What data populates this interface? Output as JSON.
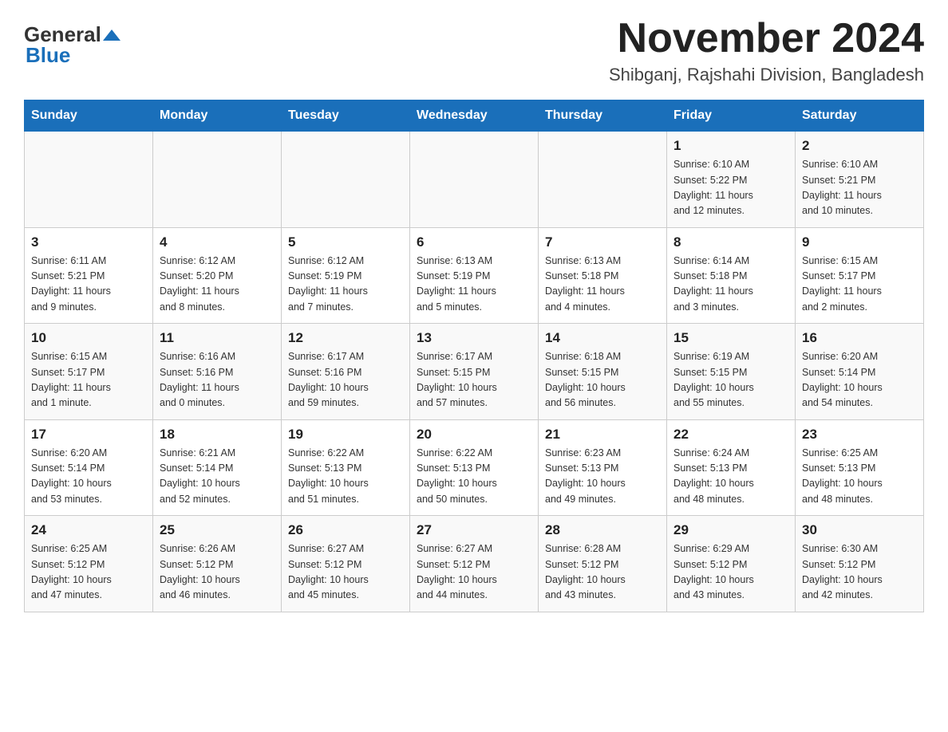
{
  "header": {
    "logo_general": "General",
    "logo_blue": "Blue",
    "month_title": "November 2024",
    "location": "Shibganj, Rajshahi Division, Bangladesh"
  },
  "weekdays": [
    "Sunday",
    "Monday",
    "Tuesday",
    "Wednesday",
    "Thursday",
    "Friday",
    "Saturday"
  ],
  "rows": [
    {
      "cells": [
        {
          "day": "",
          "info": ""
        },
        {
          "day": "",
          "info": ""
        },
        {
          "day": "",
          "info": ""
        },
        {
          "day": "",
          "info": ""
        },
        {
          "day": "",
          "info": ""
        },
        {
          "day": "1",
          "info": "Sunrise: 6:10 AM\nSunset: 5:22 PM\nDaylight: 11 hours\nand 12 minutes."
        },
        {
          "day": "2",
          "info": "Sunrise: 6:10 AM\nSunset: 5:21 PM\nDaylight: 11 hours\nand 10 minutes."
        }
      ]
    },
    {
      "cells": [
        {
          "day": "3",
          "info": "Sunrise: 6:11 AM\nSunset: 5:21 PM\nDaylight: 11 hours\nand 9 minutes."
        },
        {
          "day": "4",
          "info": "Sunrise: 6:12 AM\nSunset: 5:20 PM\nDaylight: 11 hours\nand 8 minutes."
        },
        {
          "day": "5",
          "info": "Sunrise: 6:12 AM\nSunset: 5:19 PM\nDaylight: 11 hours\nand 7 minutes."
        },
        {
          "day": "6",
          "info": "Sunrise: 6:13 AM\nSunset: 5:19 PM\nDaylight: 11 hours\nand 5 minutes."
        },
        {
          "day": "7",
          "info": "Sunrise: 6:13 AM\nSunset: 5:18 PM\nDaylight: 11 hours\nand 4 minutes."
        },
        {
          "day": "8",
          "info": "Sunrise: 6:14 AM\nSunset: 5:18 PM\nDaylight: 11 hours\nand 3 minutes."
        },
        {
          "day": "9",
          "info": "Sunrise: 6:15 AM\nSunset: 5:17 PM\nDaylight: 11 hours\nand 2 minutes."
        }
      ]
    },
    {
      "cells": [
        {
          "day": "10",
          "info": "Sunrise: 6:15 AM\nSunset: 5:17 PM\nDaylight: 11 hours\nand 1 minute."
        },
        {
          "day": "11",
          "info": "Sunrise: 6:16 AM\nSunset: 5:16 PM\nDaylight: 11 hours\nand 0 minutes."
        },
        {
          "day": "12",
          "info": "Sunrise: 6:17 AM\nSunset: 5:16 PM\nDaylight: 10 hours\nand 59 minutes."
        },
        {
          "day": "13",
          "info": "Sunrise: 6:17 AM\nSunset: 5:15 PM\nDaylight: 10 hours\nand 57 minutes."
        },
        {
          "day": "14",
          "info": "Sunrise: 6:18 AM\nSunset: 5:15 PM\nDaylight: 10 hours\nand 56 minutes."
        },
        {
          "day": "15",
          "info": "Sunrise: 6:19 AM\nSunset: 5:15 PM\nDaylight: 10 hours\nand 55 minutes."
        },
        {
          "day": "16",
          "info": "Sunrise: 6:20 AM\nSunset: 5:14 PM\nDaylight: 10 hours\nand 54 minutes."
        }
      ]
    },
    {
      "cells": [
        {
          "day": "17",
          "info": "Sunrise: 6:20 AM\nSunset: 5:14 PM\nDaylight: 10 hours\nand 53 minutes."
        },
        {
          "day": "18",
          "info": "Sunrise: 6:21 AM\nSunset: 5:14 PM\nDaylight: 10 hours\nand 52 minutes."
        },
        {
          "day": "19",
          "info": "Sunrise: 6:22 AM\nSunset: 5:13 PM\nDaylight: 10 hours\nand 51 minutes."
        },
        {
          "day": "20",
          "info": "Sunrise: 6:22 AM\nSunset: 5:13 PM\nDaylight: 10 hours\nand 50 minutes."
        },
        {
          "day": "21",
          "info": "Sunrise: 6:23 AM\nSunset: 5:13 PM\nDaylight: 10 hours\nand 49 minutes."
        },
        {
          "day": "22",
          "info": "Sunrise: 6:24 AM\nSunset: 5:13 PM\nDaylight: 10 hours\nand 48 minutes."
        },
        {
          "day": "23",
          "info": "Sunrise: 6:25 AM\nSunset: 5:13 PM\nDaylight: 10 hours\nand 48 minutes."
        }
      ]
    },
    {
      "cells": [
        {
          "day": "24",
          "info": "Sunrise: 6:25 AM\nSunset: 5:12 PM\nDaylight: 10 hours\nand 47 minutes."
        },
        {
          "day": "25",
          "info": "Sunrise: 6:26 AM\nSunset: 5:12 PM\nDaylight: 10 hours\nand 46 minutes."
        },
        {
          "day": "26",
          "info": "Sunrise: 6:27 AM\nSunset: 5:12 PM\nDaylight: 10 hours\nand 45 minutes."
        },
        {
          "day": "27",
          "info": "Sunrise: 6:27 AM\nSunset: 5:12 PM\nDaylight: 10 hours\nand 44 minutes."
        },
        {
          "day": "28",
          "info": "Sunrise: 6:28 AM\nSunset: 5:12 PM\nDaylight: 10 hours\nand 43 minutes."
        },
        {
          "day": "29",
          "info": "Sunrise: 6:29 AM\nSunset: 5:12 PM\nDaylight: 10 hours\nand 43 minutes."
        },
        {
          "day": "30",
          "info": "Sunrise: 6:30 AM\nSunset: 5:12 PM\nDaylight: 10 hours\nand 42 minutes."
        }
      ]
    }
  ]
}
